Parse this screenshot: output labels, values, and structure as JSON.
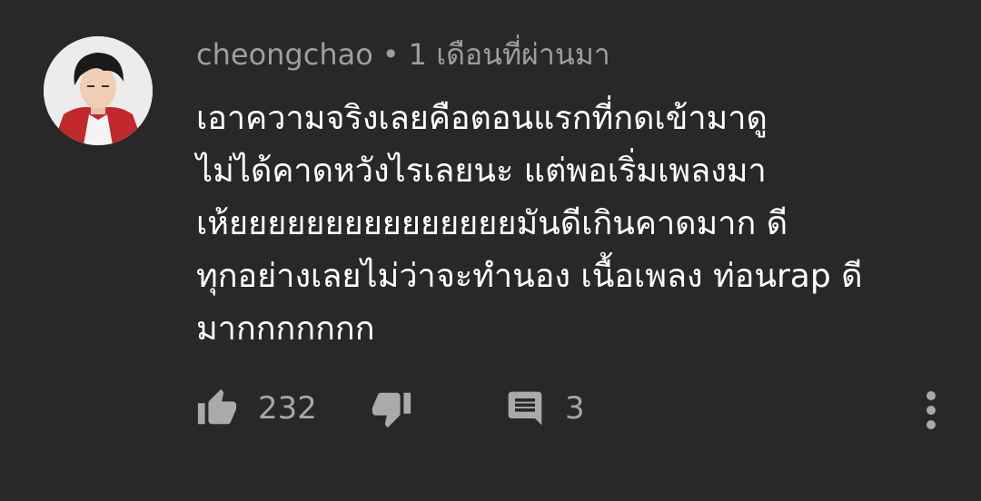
{
  "comment": {
    "author": "cheongchao",
    "separator": "•",
    "timestamp": "1 เดือนที่ผ่านมา",
    "text_lines": [
      "เอาความจริงเลยคือตอนแรกที่กดเข้ามาดู",
      "ไม่ได้คาดหวังไรเลยนะ แต่พอเริ่มเพลงมา",
      "เห้ยยยยยยยยยยยยยยยมันดีเกินคาดมาก ดี",
      "ทุกอย่างเลยไม่ว่าจะทำนอง เนื้อเพลง ท่อนrap ดี",
      "มากกกกกกก"
    ]
  },
  "actions": {
    "like_count": "232",
    "reply_count": "3"
  },
  "icons": {
    "like": "thumb-up-icon",
    "dislike": "thumb-down-icon",
    "reply": "comment-icon",
    "more": "more-vert-icon"
  },
  "colors": {
    "background": "#282828",
    "meta_text": "#9e9e9e",
    "body_text": "#ffffff",
    "icon": "#aaaaaa"
  }
}
